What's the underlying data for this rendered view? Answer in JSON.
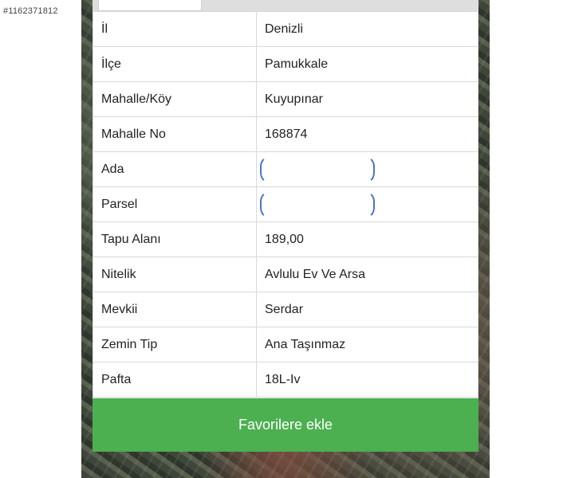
{
  "watermark": "#1162371812",
  "rows": [
    {
      "label": "İl",
      "value": "Denizli"
    },
    {
      "label": "İlçe",
      "value": "Pamukkale"
    },
    {
      "label": "Mahalle/Köy",
      "value": "Kuyupınar"
    },
    {
      "label": "Mahalle No",
      "value": "168874"
    },
    {
      "label": "Ada",
      "value": ""
    },
    {
      "label": "Parsel",
      "value": ""
    },
    {
      "label": "Tapu Alanı",
      "value": "189,00"
    },
    {
      "label": "Nitelik",
      "value": "Avlulu Ev Ve Arsa"
    },
    {
      "label": "Mevkii",
      "value": "Serdar"
    },
    {
      "label": "Zemin Tip",
      "value": "Ana Taşınmaz"
    },
    {
      "label": "Pafta",
      "value": "18L-Iv"
    }
  ],
  "favorite_button_label": "Favorilere ekle",
  "colors": {
    "button": "#4caf50",
    "redaction_outline": "#4a74c9"
  }
}
